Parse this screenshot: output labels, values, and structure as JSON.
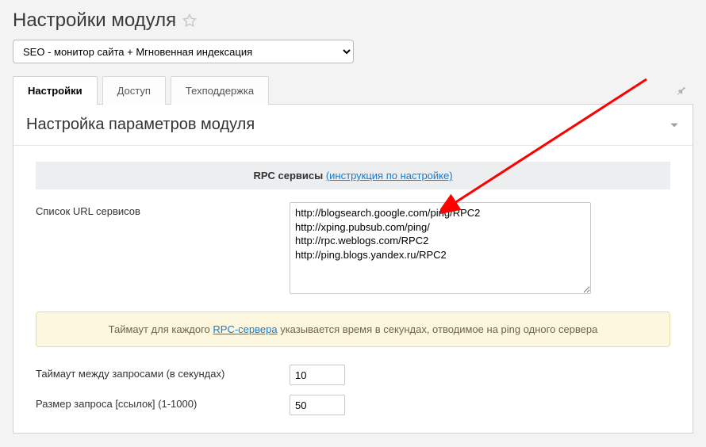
{
  "page": {
    "title": "Настройки модуля"
  },
  "module_select": {
    "value": "SEO - монитор сайта + Мгновенная индексация"
  },
  "tabs": [
    {
      "label": "Настройки",
      "active": true
    },
    {
      "label": "Доступ",
      "active": false
    },
    {
      "label": "Техподдержка",
      "active": false
    }
  ],
  "panel": {
    "heading": "Настройка параметров модуля"
  },
  "rpc_section": {
    "title_strong": "RPC сервисы",
    "title_link": "(инструкция по настройке)",
    "list_label": "Список URL сервисов",
    "list_value": "http://blogsearch.google.com/ping/RPC2\nhttp://xping.pubsub.com/ping/\nhttp://rpc.weblogs.com/RPC2\nhttp://ping.blogs.yandex.ru/RPC2"
  },
  "callout": {
    "prefix": "Таймаут для каждого ",
    "link": "RPC-сервера",
    "suffix": " указывается время в секундах, отводимое на ping одного сервера"
  },
  "fields": {
    "timeout_label": "Таймаут между запросами (в секундах)",
    "timeout_value": "10",
    "batch_label": "Размер запроса [ссылок] (1-1000)",
    "batch_value": "50"
  }
}
